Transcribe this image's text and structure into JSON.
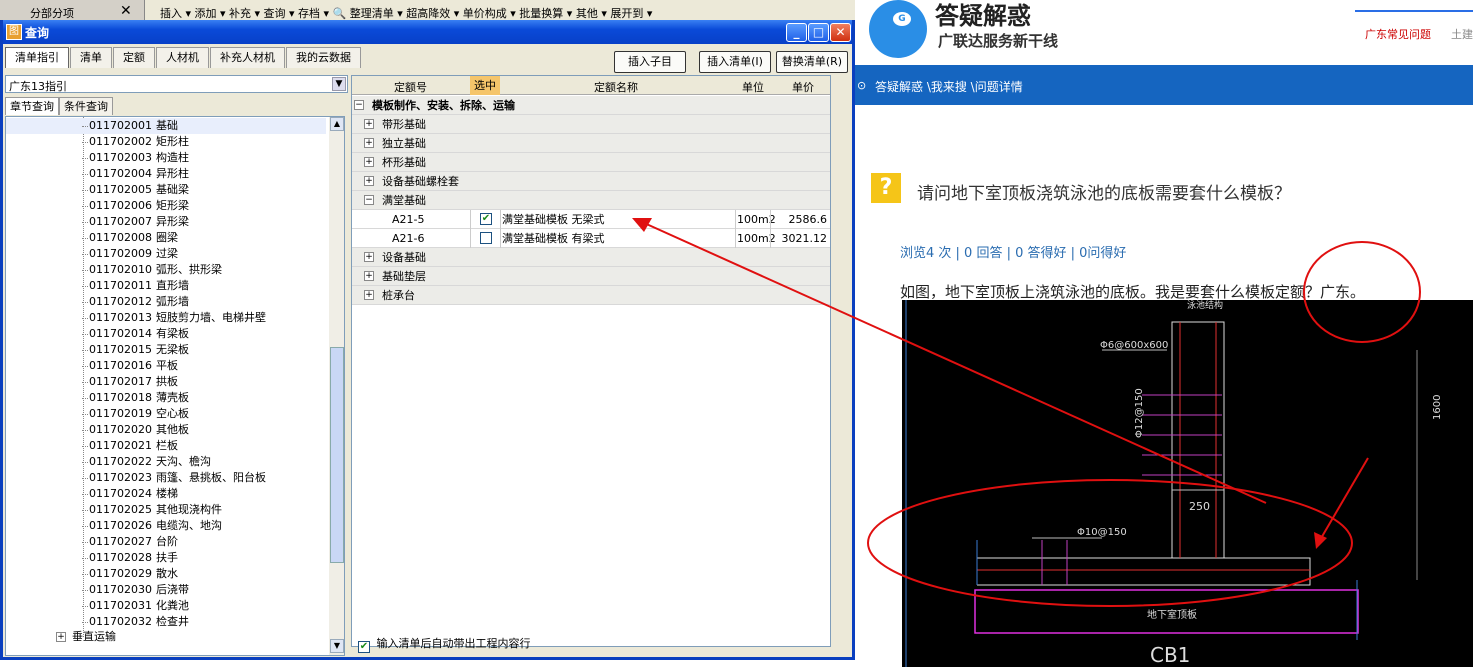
{
  "bg_app": {
    "tab_label": "分部分项",
    "close_glyph": "✕",
    "menu_text": "插入 ▾  添加 ▾  补充 ▾  查询 ▾  存档 ▾  🔍  整理清单 ▾  超高降效 ▾  单价构成 ▾  批量换算 ▾  其他 ▾  展开到 ▾"
  },
  "dialog": {
    "title": "查询",
    "title_icon": "图",
    "controls": {
      "minimize": "_",
      "maximize": "□",
      "close": "✕"
    },
    "tabs": [
      "清单指引",
      "清单",
      "定额",
      "人材机",
      "补充人材机",
      "我的云数据"
    ],
    "active_tab": "清单指引",
    "buttons": {
      "insert_child": "插入子目",
      "insert_bill": "插入清单(I)",
      "replace_bill": "替换清单(R)"
    },
    "combo_value": "广东13指引",
    "subtabs": [
      "章节查询",
      "条件查询"
    ],
    "tree_items": [
      {
        "code": "011702001",
        "name": "基础"
      },
      {
        "code": "011702002",
        "name": "矩形柱"
      },
      {
        "code": "011702003",
        "name": "构造柱"
      },
      {
        "code": "011702004",
        "name": "异形柱"
      },
      {
        "code": "011702005",
        "name": "基础梁"
      },
      {
        "code": "011702006",
        "name": "矩形梁"
      },
      {
        "code": "011702007",
        "name": "异形梁"
      },
      {
        "code": "011702008",
        "name": "圈梁"
      },
      {
        "code": "011702009",
        "name": "过梁"
      },
      {
        "code": "011702010",
        "name": "弧形、拱形梁"
      },
      {
        "code": "011702011",
        "name": "直形墙"
      },
      {
        "code": "011702012",
        "name": "弧形墙"
      },
      {
        "code": "011702013",
        "name": "短肢剪力墙、电梯井壁"
      },
      {
        "code": "011702014",
        "name": "有梁板"
      },
      {
        "code": "011702015",
        "name": "无梁板"
      },
      {
        "code": "011702016",
        "name": "平板"
      },
      {
        "code": "011702017",
        "name": "拱板"
      },
      {
        "code": "011702018",
        "name": "薄壳板"
      },
      {
        "code": "011702019",
        "name": "空心板"
      },
      {
        "code": "011702020",
        "name": "其他板"
      },
      {
        "code": "011702021",
        "name": "栏板"
      },
      {
        "code": "011702022",
        "name": "天沟、檐沟"
      },
      {
        "code": "011702023",
        "name": "雨篷、悬挑板、阳台板"
      },
      {
        "code": "011702024",
        "name": "楼梯"
      },
      {
        "code": "011702025",
        "name": "其他现浇构件"
      },
      {
        "code": "011702026",
        "name": "电缆沟、地沟"
      },
      {
        "code": "011702027",
        "name": "台阶"
      },
      {
        "code": "011702028",
        "name": "扶手"
      },
      {
        "code": "011702029",
        "name": "散水"
      },
      {
        "code": "011702030",
        "name": "后浇带"
      },
      {
        "code": "011702031",
        "name": "化粪池"
      },
      {
        "code": "011702032",
        "name": "检查井"
      }
    ],
    "tree_tail": {
      "node": "垂直运输",
      "expander": "+"
    },
    "grid_headers": {
      "code": "定额号",
      "selected": "选中",
      "name": "定额名称",
      "unit": "单位",
      "price": "单价"
    },
    "grid_rows": [
      {
        "kind": "root",
        "expander": "−",
        "label": "模板制作、安装、拆除、运输"
      },
      {
        "kind": "group",
        "expander": "+",
        "label": "带形基础"
      },
      {
        "kind": "group",
        "expander": "+",
        "label": "独立基础"
      },
      {
        "kind": "group",
        "expander": "+",
        "label": "杯形基础"
      },
      {
        "kind": "group",
        "expander": "+",
        "label": "设备基础螺栓套"
      },
      {
        "kind": "group",
        "expander": "−",
        "label": "满堂基础"
      },
      {
        "kind": "item",
        "code": "A21-5",
        "checked": "✔",
        "name": "满堂基础模板 无梁式",
        "unit": "100m2",
        "price": "2586.6"
      },
      {
        "kind": "item",
        "code": "A21-6",
        "checked": "",
        "name": "满堂基础模板 有梁式",
        "unit": "100m2",
        "price": "3021.12"
      },
      {
        "kind": "group",
        "expander": "+",
        "label": "设备基础"
      },
      {
        "kind": "group",
        "expander": "+",
        "label": "基础垫层"
      },
      {
        "kind": "group",
        "expander": "+",
        "label": "桩承台"
      }
    ],
    "auto_check": {
      "checked": "✔",
      "label": "输入清单后自动带出工程内容行"
    }
  },
  "web": {
    "logo_title": "答疑解惑",
    "logo_sub": "广联达服务新干线",
    "logo_mark": "G",
    "faq_link": "广东常见问题",
    "faq_extra": "土建",
    "nav_pin": "⊙",
    "breadcrumb": "答疑解惑 \\我来搜 \\问题详情",
    "question_icon": "?",
    "question_title": "请问地下室顶板浇筑泳池的底板需要套什么模板？",
    "stats": "浏览4 次 | 0 回答 | 0 答得好 | 0问得好",
    "description": "如图，地下室顶板上浇筑泳池的底板。我是要套什么模板定额？广东。",
    "cad_labels": {
      "top": "泳池结构",
      "rebar1": "Φ6@600x600",
      "rebar2": "Φ12@150",
      "dim250": "250",
      "rebar3": "Φ10@150",
      "dim_right": "1600",
      "slab": "地下室顶板",
      "caption": "CB1"
    }
  },
  "colors": {
    "annotation_red": "#e01010",
    "xp_blue": "#0a4ad8",
    "nav_blue": "#1565c0"
  }
}
